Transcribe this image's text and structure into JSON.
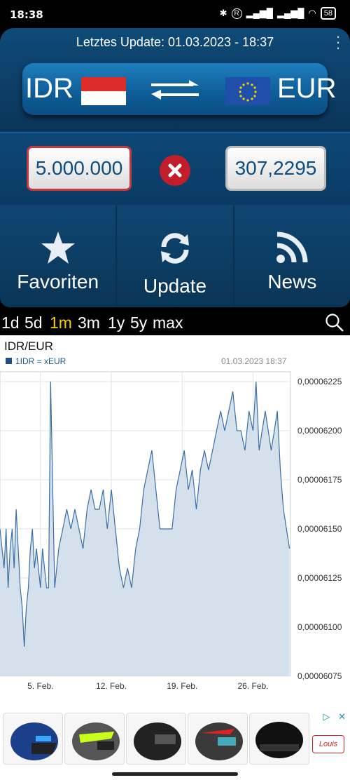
{
  "status": {
    "time": "18:38",
    "battery": "58",
    "indicator": "R"
  },
  "header": {
    "last_update": "Letztes Update: 01.03.2023 - 18:37"
  },
  "pair": {
    "from_code": "IDR",
    "to_code": "EUR",
    "from_flag_icon": "flag-indonesia-icon",
    "to_flag_icon": "flag-eu-icon",
    "swap_icon": "swap-arrows-icon"
  },
  "amounts": {
    "from_value": "5.000.000",
    "to_value": "307,2295"
  },
  "nav": [
    {
      "label": "Favoriten",
      "icon": "star-icon"
    },
    {
      "label": "Update",
      "icon": "refresh-icon"
    },
    {
      "label": "News",
      "icon": "rss-icon"
    }
  ],
  "ranges": [
    "1d",
    "5d",
    "1m",
    "3m",
    "1y",
    "5y",
    "max"
  ],
  "active_range": "1m",
  "chart_data": {
    "type": "area",
    "title": "IDR/EUR",
    "legend": "1IDR = xEUR",
    "timestamp": "01.03.2023 18:37",
    "ylim": [
      6.075e-05,
      6.23e-05
    ],
    "y_ticks": [
      "0,00006225",
      "0,00006200",
      "0,00006175",
      "0,00006150",
      "0,00006125",
      "0,00006100",
      "0,00006075"
    ],
    "y_tick_values": [
      6.225e-05,
      6.2e-05,
      6.175e-05,
      6.15e-05,
      6.125e-05,
      6.1e-05,
      6.075e-05
    ],
    "x_ticks": [
      "5. Feb.",
      "12. Feb.",
      "19. Feb.",
      "26. Feb."
    ],
    "x_tick_days": [
      5,
      12,
      19,
      26
    ],
    "xlim": [
      1,
      29.7
    ],
    "grid": true,
    "x": [
      1.0,
      1.2,
      1.4,
      1.6,
      1.8,
      2.0,
      2.2,
      2.4,
      2.6,
      2.8,
      3.0,
      3.2,
      3.4,
      3.6,
      3.8,
      4.0,
      4.2,
      4.4,
      4.6,
      4.8,
      5.0,
      5.2,
      5.4,
      5.6,
      5.8,
      6.0,
      6.4,
      6.8,
      7.2,
      7.6,
      8.0,
      8.4,
      8.8,
      9.2,
      9.6,
      10.0,
      10.4,
      10.8,
      11.2,
      11.6,
      12.0,
      12.4,
      12.8,
      13.2,
      13.6,
      14.0,
      14.4,
      14.8,
      15.2,
      15.6,
      16.0,
      16.4,
      16.8,
      17.2,
      17.6,
      18.0,
      18.4,
      18.8,
      19.2,
      19.6,
      20.0,
      20.4,
      20.8,
      21.2,
      21.6,
      22.0,
      22.4,
      22.8,
      23.2,
      23.6,
      24.0,
      24.4,
      24.8,
      25.2,
      25.6,
      26.0,
      26.3,
      26.6,
      26.9,
      27.2,
      27.5,
      27.8,
      28.1,
      28.4,
      28.7,
      29.0,
      29.3,
      29.6
    ],
    "values": [
      6.15e-05,
      6.14e-05,
      6.13e-05,
      6.15e-05,
      6.12e-05,
      6.14e-05,
      6.15e-05,
      6.13e-05,
      6.16e-05,
      6.14e-05,
      6.12e-05,
      6.11e-05,
      6.09e-05,
      6.11e-05,
      6.12e-05,
      6.14e-05,
      6.15e-05,
      6.13e-05,
      6.14e-05,
      6.13e-05,
      6.12e-05,
      6.14e-05,
      6.13e-05,
      6.12e-05,
      6.12e-05,
      6.225e-05,
      6.12e-05,
      6.14e-05,
      6.15e-05,
      6.16e-05,
      6.15e-05,
      6.16e-05,
      6.15e-05,
      6.14e-05,
      6.16e-05,
      6.17e-05,
      6.16e-05,
      6.16e-05,
      6.17e-05,
      6.15e-05,
      6.17e-05,
      6.15e-05,
      6.13e-05,
      6.12e-05,
      6.13e-05,
      6.12e-05,
      6.14e-05,
      6.15e-05,
      6.17e-05,
      6.18e-05,
      6.19e-05,
      6.17e-05,
      6.15e-05,
      6.15e-05,
      6.15e-05,
      6.15e-05,
      6.17e-05,
      6.18e-05,
      6.19e-05,
      6.17e-05,
      6.18e-05,
      6.16e-05,
      6.18e-05,
      6.19e-05,
      6.18e-05,
      6.19e-05,
      6.2e-05,
      6.21e-05,
      6.2e-05,
      6.21e-05,
      6.22e-05,
      6.2e-05,
      6.2e-05,
      6.19e-05,
      6.21e-05,
      6.2e-05,
      6.225e-05,
      6.19e-05,
      6.2e-05,
      6.21e-05,
      6.2e-05,
      6.19e-05,
      6.2e-05,
      6.21e-05,
      6.18e-05,
      6.16e-05,
      6.15e-05,
      6.14e-05
    ]
  },
  "ads": {
    "thumb_count": 5,
    "badge_icons": [
      "adchoices-icon",
      "close-icon"
    ]
  }
}
